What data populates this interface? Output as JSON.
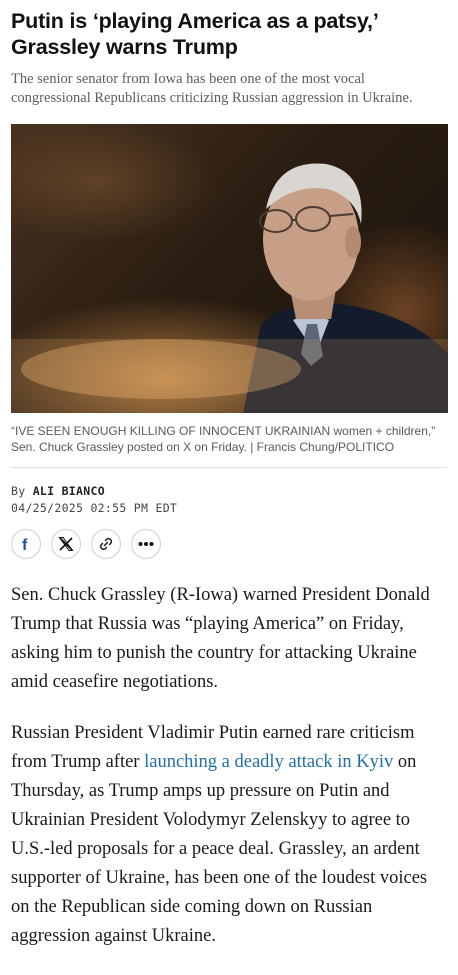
{
  "article": {
    "headline": "Putin is ‘playing America as a patsy,’ Grassley warns Trump",
    "dek": "The senior senator from Iowa has been one of the most vocal congressional Republicans criticizing Russian aggression in Ukraine.",
    "photo": {
      "caption": "“IVE SEEN ENOUGH KILLING OF INNOCENT UKRAINIAN women + children,” Sen. Chuck Grassley posted on X on Friday. | Francis Chung/POLITICO"
    },
    "byline": {
      "prefix": "By",
      "author": "ALI BIANCO",
      "timestamp": "04/25/2025 02:55 PM EDT"
    },
    "share": {
      "facebook_icon": "facebook-icon",
      "x_icon": "x-icon",
      "link_icon": "link-icon",
      "more_icon": "more-icon"
    },
    "body": {
      "p1": "Sen. Chuck Grassley (R-Iowa) warned President Donald Trump that Russia was “playing America” on Friday, asking him to punish the country for attacking Ukraine amid ceasefire negotiations.",
      "p2_before_link": "Russian President Vladimir Putin earned rare criticism from Trump after ",
      "p2_link": "launching a deadly attack in Kyiv",
      "p2_after_link": " on Thursday, as Trump amps up pressure on Putin and Ukrainian President Volodymyr Zelenskyy to agree to U.S.-led proposals for a peace deal. Grassley, an ardent supporter of Ukraine, has been one of the loudest voices on the Republican side coming down on Russian aggression against Ukraine."
    }
  },
  "colors": {
    "link": "#1f6fa8",
    "facebook": "#1f4fa0"
  }
}
